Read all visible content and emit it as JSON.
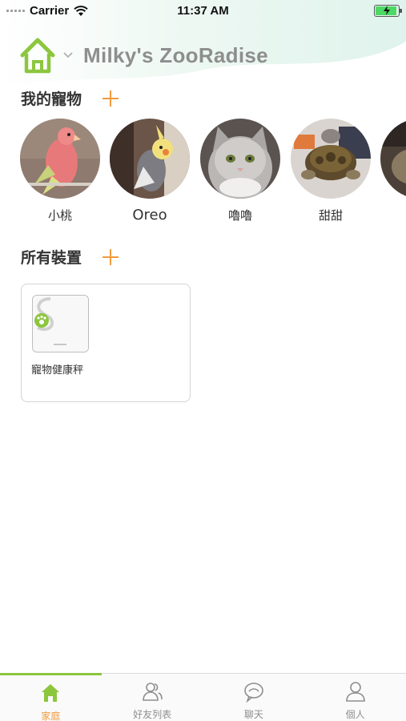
{
  "status_bar": {
    "carrier": "Carrier",
    "time": "11:37 AM"
  },
  "header": {
    "home_name": "Milky's ZooRadise",
    "home_icon": "house-icon",
    "dropdown_icon": "chevron-down-icon"
  },
  "pets_section": {
    "title": "我的寵物",
    "add_icon": "plus-icon",
    "pets": [
      {
        "name": "小桃",
        "photo": "bird-pink-parrot"
      },
      {
        "name": "Oreo",
        "photo": "bird-cockatiel"
      },
      {
        "name": "嚕嚕",
        "photo": "cat-grey"
      },
      {
        "name": "甜甜",
        "photo": "tortoise"
      }
    ]
  },
  "devices_section": {
    "title": "所有裝置",
    "add_icon": "plus-icon",
    "devices": [
      {
        "name": "寵物健康秤",
        "icon": "pet-scale-icon"
      }
    ]
  },
  "tab_bar": {
    "tabs": [
      {
        "label": "家庭",
        "icon": "home-icon",
        "active": true
      },
      {
        "label": "好友列表",
        "icon": "friends-icon",
        "active": false
      },
      {
        "label": "聊天",
        "icon": "chat-icon",
        "active": false
      },
      {
        "label": "個人",
        "icon": "person-icon",
        "active": false
      }
    ]
  },
  "colors": {
    "accent_orange": "#f19a3e",
    "accent_green": "#8cc63e",
    "title_grey": "#8e8e8e"
  }
}
